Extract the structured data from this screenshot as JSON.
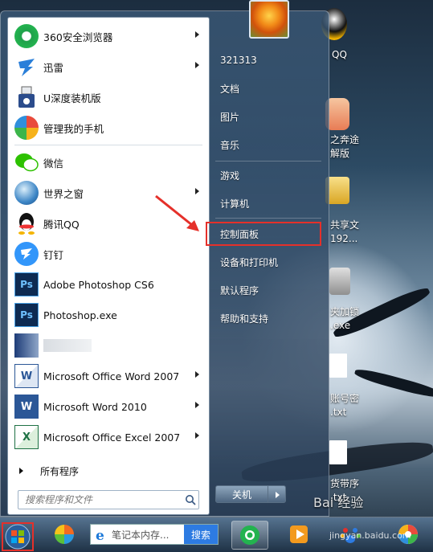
{
  "desktop": {
    "icons": [
      {
        "label": "QQ"
      },
      {
        "label": "之奔途"
      },
      {
        "label": "解版"
      },
      {
        "label": "共享文"
      },
      {
        "label": "192..."
      },
      {
        "label": "夹加锁"
      },
      {
        "label": ".exe"
      },
      {
        "label": "账号密"
      },
      {
        "label": ".txt"
      },
      {
        "label": "货带序"
      },
      {
        "label": ".txt"
      }
    ]
  },
  "start_menu": {
    "programs": [
      {
        "label": "360安全浏览器",
        "icon": "360-browser-icon",
        "has_submenu": true
      },
      {
        "label": "迅雷",
        "icon": "xunlei-icon",
        "has_submenu": true
      },
      {
        "label": "U深度装机版",
        "icon": "usb-install-icon",
        "has_submenu": false
      },
      {
        "label": "管理我的手机",
        "icon": "phone-manager-icon",
        "has_submenu": false
      },
      {
        "label": "微信",
        "icon": "wechat-icon",
        "has_submenu": false
      },
      {
        "label": "世界之窗",
        "icon": "theworld-browser-icon",
        "has_submenu": true
      },
      {
        "label": "腾讯QQ",
        "icon": "qq-icon",
        "has_submenu": false
      },
      {
        "label": "钉钉",
        "icon": "dingtalk-icon",
        "has_submenu": false
      },
      {
        "label": "Adobe Photoshop CS6",
        "icon": "photoshop-icon",
        "has_submenu": false
      },
      {
        "label": "Photoshop.exe",
        "icon": "photoshop-icon",
        "has_submenu": false
      },
      {
        "label": "",
        "icon": "blurred-app-icon",
        "has_submenu": false
      },
      {
        "label": "Microsoft Office Word 2007",
        "icon": "word-icon",
        "has_submenu": true
      },
      {
        "label": "Microsoft Word 2010",
        "icon": "word-icon",
        "has_submenu": true
      },
      {
        "label": "Microsoft Office Excel 2007",
        "icon": "excel-icon",
        "has_submenu": true
      }
    ],
    "all_programs": "所有程序",
    "search_placeholder": "搜索程序和文件",
    "right_items": [
      {
        "label": "321313"
      },
      {
        "label": "文档"
      },
      {
        "label": "图片"
      },
      {
        "label": "音乐"
      },
      {
        "label": "游戏"
      },
      {
        "label": "计算机"
      },
      {
        "label": "控制面板"
      },
      {
        "label": "设备和打印机"
      },
      {
        "label": "默认程序"
      },
      {
        "label": "帮助和支持"
      }
    ],
    "shutdown_label": "关机"
  },
  "taskbar": {
    "search_text": "笔记本内存...",
    "search_button": "搜索"
  },
  "watermark": {
    "text": "Bai 经验",
    "sub": "jingyan.baidu.com"
  },
  "colors": {
    "highlight_red": "#e5302a",
    "search_blue": "#2d7be2"
  }
}
